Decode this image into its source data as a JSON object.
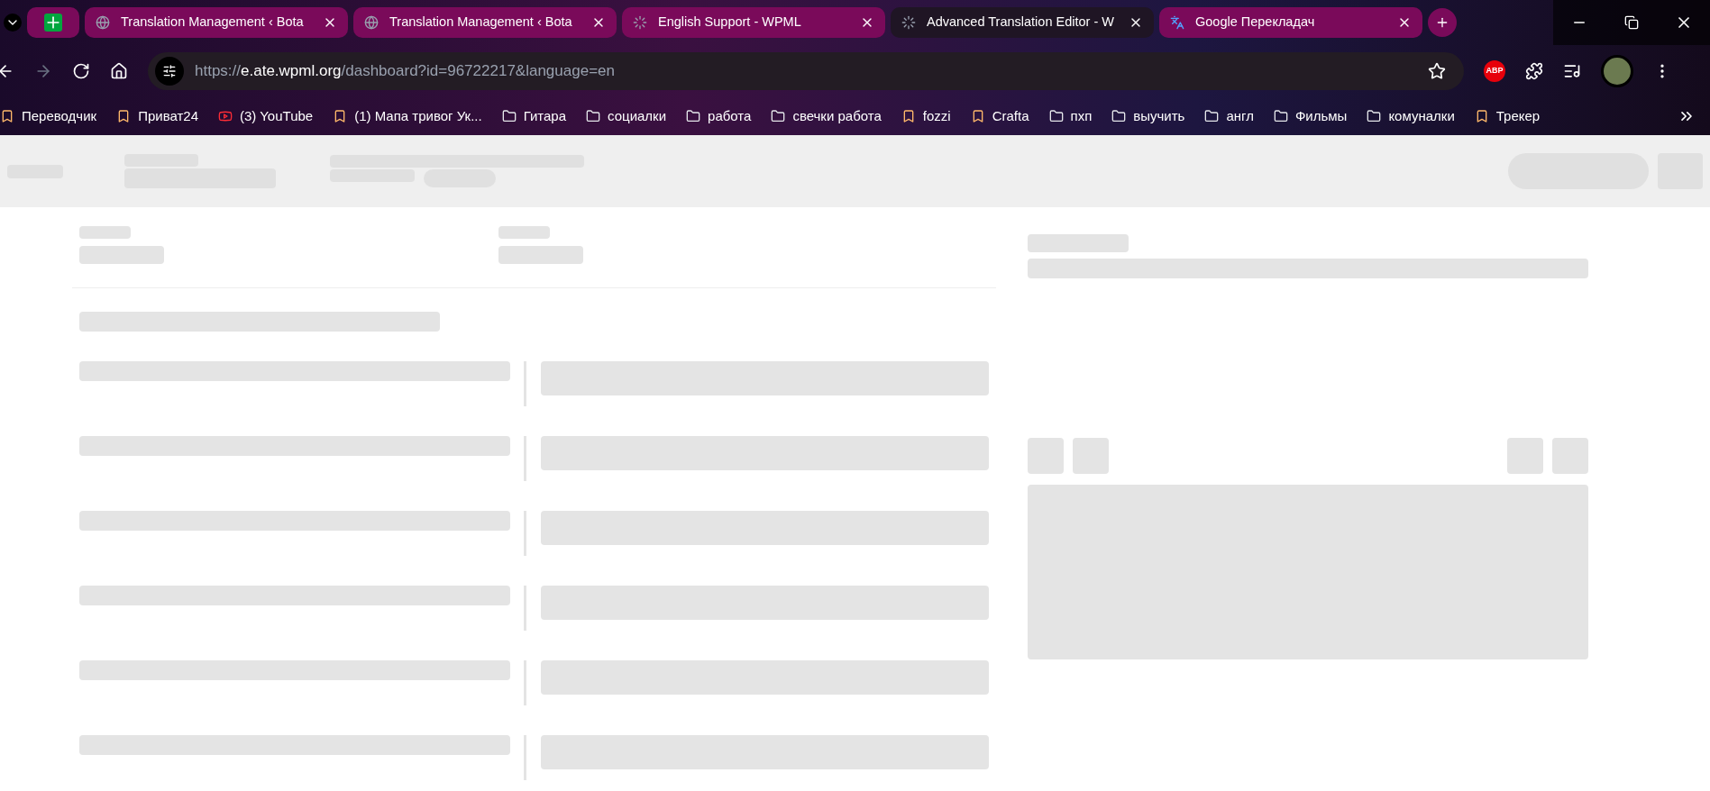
{
  "tabs": [
    {
      "title": "Translation Management ‹ Bota",
      "selected": false,
      "kind": "globe"
    },
    {
      "title": "Translation Management ‹ Bota",
      "selected": false,
      "kind": "globe"
    },
    {
      "title": "English Support - WPML",
      "selected": false,
      "kind": "loading"
    },
    {
      "title": "Advanced Translation Editor - W",
      "selected": true,
      "kind": "loading"
    },
    {
      "title": "Google Перекладач",
      "selected": false,
      "kind": "translate"
    }
  ],
  "address_bar": {
    "scheme": "https://",
    "host": "e.ate.wpml.org",
    "path": "/dashboard?id=96722217&language=en"
  },
  "extension_badge": "ABP",
  "bookmarks": [
    {
      "label": "Переводчик",
      "kind": "site"
    },
    {
      "label": "Приват24",
      "kind": "site"
    },
    {
      "label": "(3) YouTube",
      "kind": "video"
    },
    {
      "label": "(1) Мапа тривог Ук...",
      "kind": "site"
    },
    {
      "label": "Гитара",
      "kind": "folder"
    },
    {
      "label": "социалки",
      "kind": "folder"
    },
    {
      "label": "работа",
      "kind": "folder"
    },
    {
      "label": "свечки работа",
      "kind": "folder"
    },
    {
      "label": "fozzi",
      "kind": "site"
    },
    {
      "label": "Crafta",
      "kind": "site"
    },
    {
      "label": "пхп",
      "kind": "folder"
    },
    {
      "label": "выучить",
      "kind": "folder"
    },
    {
      "label": "англ",
      "kind": "folder"
    },
    {
      "label": "Фильмы",
      "kind": "folder"
    },
    {
      "label": "комуналки",
      "kind": "folder"
    },
    {
      "label": "Трекер",
      "kind": "site"
    }
  ]
}
